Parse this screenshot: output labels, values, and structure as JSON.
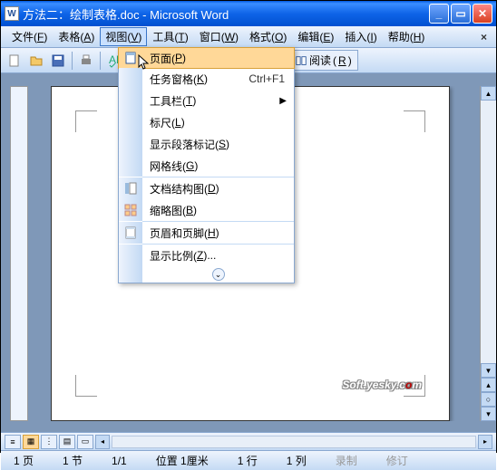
{
  "title": "方法二：绘制表格.doc - Microsoft Word",
  "menubar": {
    "items": [
      {
        "label": "文件",
        "key": "F"
      },
      {
        "label": "表格",
        "key": "A"
      },
      {
        "label": "视图",
        "key": "V"
      },
      {
        "label": "工具",
        "key": "T"
      },
      {
        "label": "窗口",
        "key": "W"
      },
      {
        "label": "格式",
        "key": "O"
      },
      {
        "label": "编辑",
        "key": "E"
      },
      {
        "label": "插入",
        "key": "I"
      },
      {
        "label": "帮助",
        "key": "H"
      }
    ]
  },
  "toolbar": {
    "read_label": "阅读",
    "read_key": "R"
  },
  "dropdown": {
    "items": [
      {
        "icon": "page-layout-icon",
        "label": "页面",
        "key": "P",
        "highlighted": true
      },
      {
        "icon": "",
        "label": "任务窗格",
        "key": "K",
        "shortcut": "Ctrl+F1"
      },
      {
        "icon": "",
        "label": "工具栏",
        "key": "T",
        "submenu": true
      },
      {
        "icon": "",
        "label": "标尺",
        "key": "L"
      },
      {
        "icon": "",
        "label": "显示段落标记",
        "key": "S"
      },
      {
        "icon": "",
        "label": "网格线",
        "key": "G"
      },
      {
        "sep": true
      },
      {
        "icon": "docmap-icon",
        "label": "文档结构图",
        "key": "D"
      },
      {
        "icon": "thumbs-icon",
        "label": "缩略图",
        "key": "B"
      },
      {
        "sep": true
      },
      {
        "icon": "header-footer-icon",
        "label": "页眉和页脚",
        "key": "H"
      },
      {
        "sep": true
      },
      {
        "icon": "",
        "label": "显示比例",
        "key": "Z",
        "ellipsis": true
      }
    ]
  },
  "watermark": {
    "pre": "Soft.yesky.c",
    "o": "o",
    "post": "m"
  },
  "statusbar": {
    "page": "1 页",
    "sec": "1 节",
    "pages": "1/1",
    "pos": "位置 1厘米",
    "line": "1 行",
    "col": "1 列",
    "rec": "录制",
    "rev": "修订"
  }
}
